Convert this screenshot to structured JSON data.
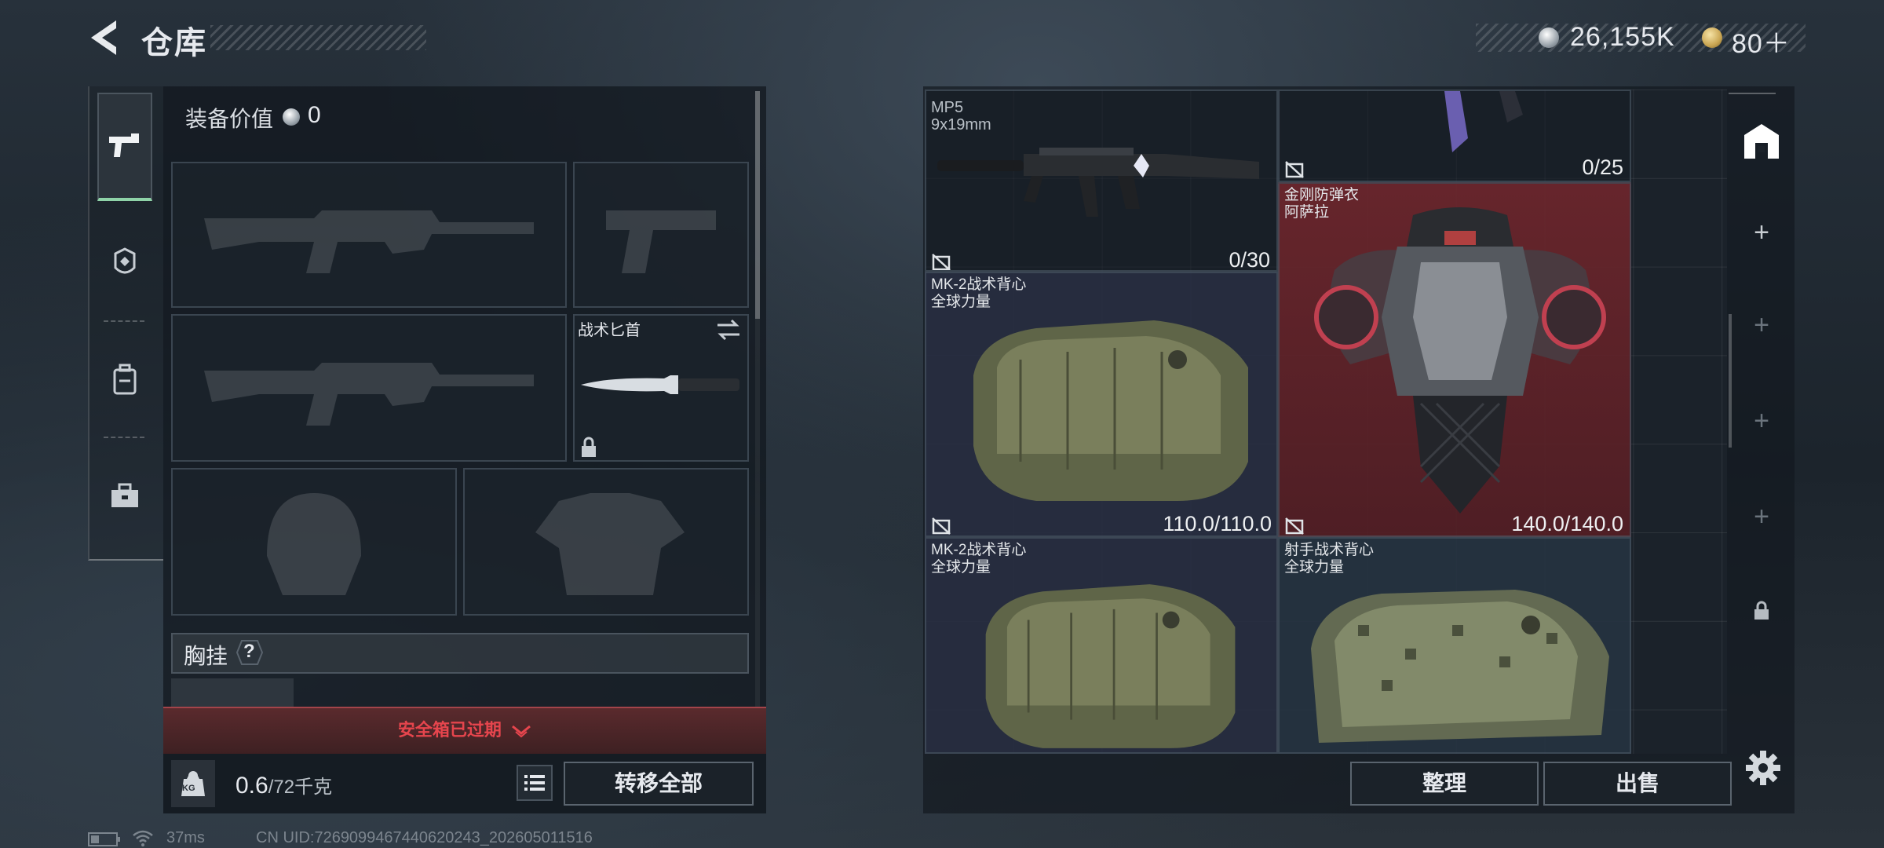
{
  "header": {
    "title": "仓库",
    "currency_silver": "26,155K",
    "currency_gold": "80＋"
  },
  "tabs": [
    {
      "icon": "pistol-icon",
      "active": true
    },
    {
      "icon": "helmet-icon",
      "active": false
    },
    {
      "icon": "backpack-icon",
      "active": false
    },
    {
      "icon": "toolbox-icon",
      "active": false
    }
  ],
  "loadout": {
    "equip_value_label": "装备价值",
    "equip_value": "0",
    "knife_label": "战术匕首",
    "chest_rig_label": "胸挂",
    "help_glyph": "?",
    "safebox_expired": "安全箱已过期",
    "weight_value": "0.6",
    "weight_max": "/72千克",
    "kg_badge": "KG",
    "move_all_label": "转移全部"
  },
  "status_bar": {
    "ping": "37ms",
    "uid": "CN UID:7269099467440620243_202605011516"
  },
  "stash_items": [
    {
      "name_line1": "MP5",
      "name_line2": "9x19mm",
      "durability": "0/30"
    },
    {
      "name_line1": "",
      "name_line2": "",
      "durability": "0/25"
    },
    {
      "name_line1": "金刚防弹衣",
      "name_line2": "阿萨拉",
      "durability": "140.0/140.0"
    },
    {
      "name_line1": "MK-2战术背心",
      "name_line2": "全球力量",
      "durability": "110.0/110.0"
    },
    {
      "name_line1": "MK-2战术背心",
      "name_line2": "全球力量",
      "durability": ""
    },
    {
      "name_line1": "射手战术背心",
      "name_line2": "全球力量",
      "durability": ""
    }
  ],
  "actions": {
    "sort_label": "整理",
    "sell_label": "出售"
  },
  "colors": {
    "accent_green": "#8fd3a8",
    "expired_red": "#e6454d",
    "rare_red": "#6e262c"
  }
}
